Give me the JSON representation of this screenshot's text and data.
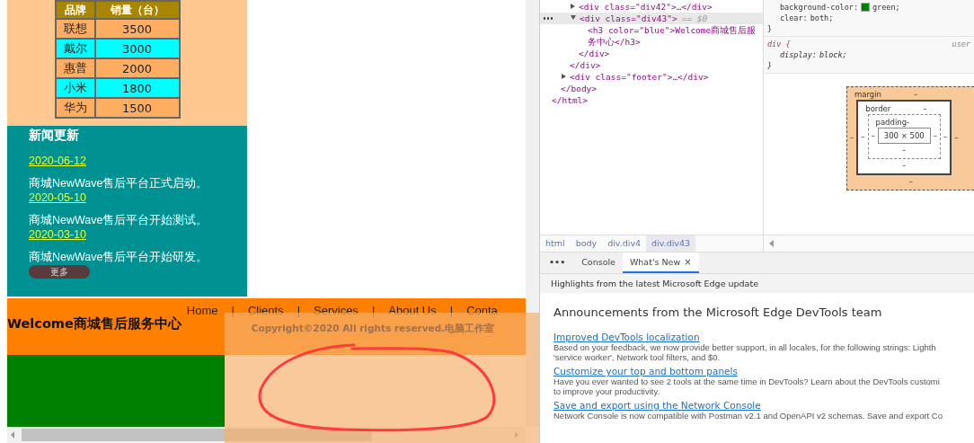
{
  "page": {
    "sales_table": {
      "columns": [
        "品牌",
        "销量（台）"
      ],
      "rows": [
        {
          "brand": "联想",
          "sales": "3500",
          "color": "#ffad60"
        },
        {
          "brand": "戴尔",
          "sales": "3000",
          "color": "#00ffff"
        },
        {
          "brand": "惠普",
          "sales": "2000",
          "color": "#ffad60"
        },
        {
          "brand": "小米",
          "sales": "1800",
          "color": "#00ffff"
        },
        {
          "brand": "华为",
          "sales": "1500",
          "color": "#ffad60"
        }
      ]
    },
    "news": {
      "title": "新闻更新",
      "items": [
        {
          "date": "2020-06-12",
          "text": "商城NewWave售后平台正式启动。"
        },
        {
          "date": "2020-05-10",
          "text": "商城NewWave售后平台开始测试。"
        },
        {
          "date": "2020-03-10",
          "text": "商城NewWave售后平台开始研发。"
        }
      ],
      "more_button": "更多"
    },
    "header": {
      "title": "Welcome商城售后服务中心",
      "nav": [
        {
          "label": "Home",
          "separator": "|"
        },
        {
          "label": "Clients",
          "separator": "|"
        },
        {
          "label": "Services",
          "separator": "|"
        },
        {
          "label": "About Us",
          "separator": "|"
        },
        {
          "label": "Conta"
        }
      ]
    },
    "footer_overlay": {
      "copyright": "Copyright©2020 All rights reserved.电脑工作室"
    }
  },
  "devtools": {
    "dom_tree": [
      {
        "close": "</html>",
        "children": [
          {
            "close": "</body>",
            "children": [
              {
                "close": "</div>",
                "children": [
                  {
                    "text": "<div class=\"div42\">…</div>",
                    "expanded": false,
                    "selected": false
                  },
                  {
                    "text": "<div class=\"div43\">",
                    "marker": "== $0",
                    "expanded": true,
                    "selected": true,
                    "close": "</div>",
                    "children": [
                      {
                        "text": "<h3 color=\"blue\">Welcome商城售后服务中心</h3>",
                        "selected": false
                      }
                    ]
                  }
                ]
              },
              {
                "text": "<div class=\"footer\">…</div>",
                "expanded": false,
                "selected": false
              }
            ]
          }
        ]
      }
    ],
    "breadcrumbs": [
      {
        "label": "html",
        "selected": false
      },
      {
        "label": "body",
        "selected": false
      },
      {
        "label": "div.div4",
        "selected": false
      },
      {
        "label": "div.div43",
        "selected": true
      }
    ],
    "styles": [
      {
        "declarations": [
          {
            "name": "background-color:",
            "value": "green;",
            "color": "#008000"
          },
          {
            "name": "clear:",
            "value": "both;"
          }
        ],
        "close": "}"
      },
      {
        "selector": "div {",
        "origin": "user",
        "kind": "user-agent",
        "declarations": [
          {
            "name": "display:",
            "value": "block;"
          }
        ],
        "close": "}"
      }
    ],
    "box_model": {
      "margin": {
        "label": "margin",
        "top": "–",
        "right": "–",
        "bottom": "–",
        "left": "–"
      },
      "border": {
        "label": "border",
        "top": "–",
        "right": "–",
        "bottom": "–",
        "left": "–"
      },
      "padding": {
        "label": "padding",
        "top": "-",
        "right": "–",
        "bottom": "–",
        "left": "–"
      },
      "content": "300 × 500"
    },
    "drawer_tabs": [
      {
        "label": "•••",
        "kind": "more",
        "selected": false
      },
      {
        "label": "Console",
        "kind": "tab",
        "selected": false
      },
      {
        "label": "What's New",
        "kind": "tab",
        "close": "×",
        "selected": true
      }
    ],
    "whats_new": {
      "subtitle": "Highlights from the latest Microsoft Edge update",
      "title": "Announcements from the Microsoft Edge DevTools team",
      "items": [
        {
          "link": "Improved DevTools localization",
          "lines": [
            "Based on your feedback, we now provide better support, in all locales, for the following strings: Lighth",
            "'service worker', Network tool filters, and $0."
          ]
        },
        {
          "link": "Customize your top and bottom panels",
          "lines": [
            "Have you ever wanted to see 2 tools at the same time in DevTools? Learn about the DevTools customi",
            "to improve your productivity."
          ]
        },
        {
          "link": "Save and export using the Network Console",
          "lines": [
            "Network Console is now compatible with Postman v2.1 and OpenAPI v2 schemas. Save and export Co"
          ]
        }
      ]
    }
  }
}
